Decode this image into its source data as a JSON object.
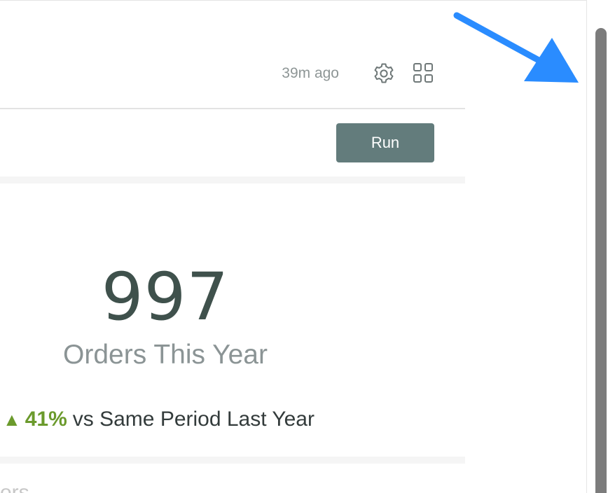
{
  "header": {
    "timestamp": "39m ago",
    "settings_icon": "gear-icon",
    "layout_icon": "tiles-icon"
  },
  "toolbar": {
    "run_label": "Run"
  },
  "metric": {
    "value": "997",
    "label": "Orders This Year",
    "comparison_arrow": "▲",
    "comparison_pct": "41%",
    "comparison_text": "vs Same Period Last Year",
    "trend_color": "#6b9a2c"
  },
  "next_tile": {
    "partial_label": "ors"
  },
  "colors": {
    "run_button": "#637c7c",
    "metric_value": "#3f514c",
    "annotation_arrow": "#2a8cff"
  }
}
